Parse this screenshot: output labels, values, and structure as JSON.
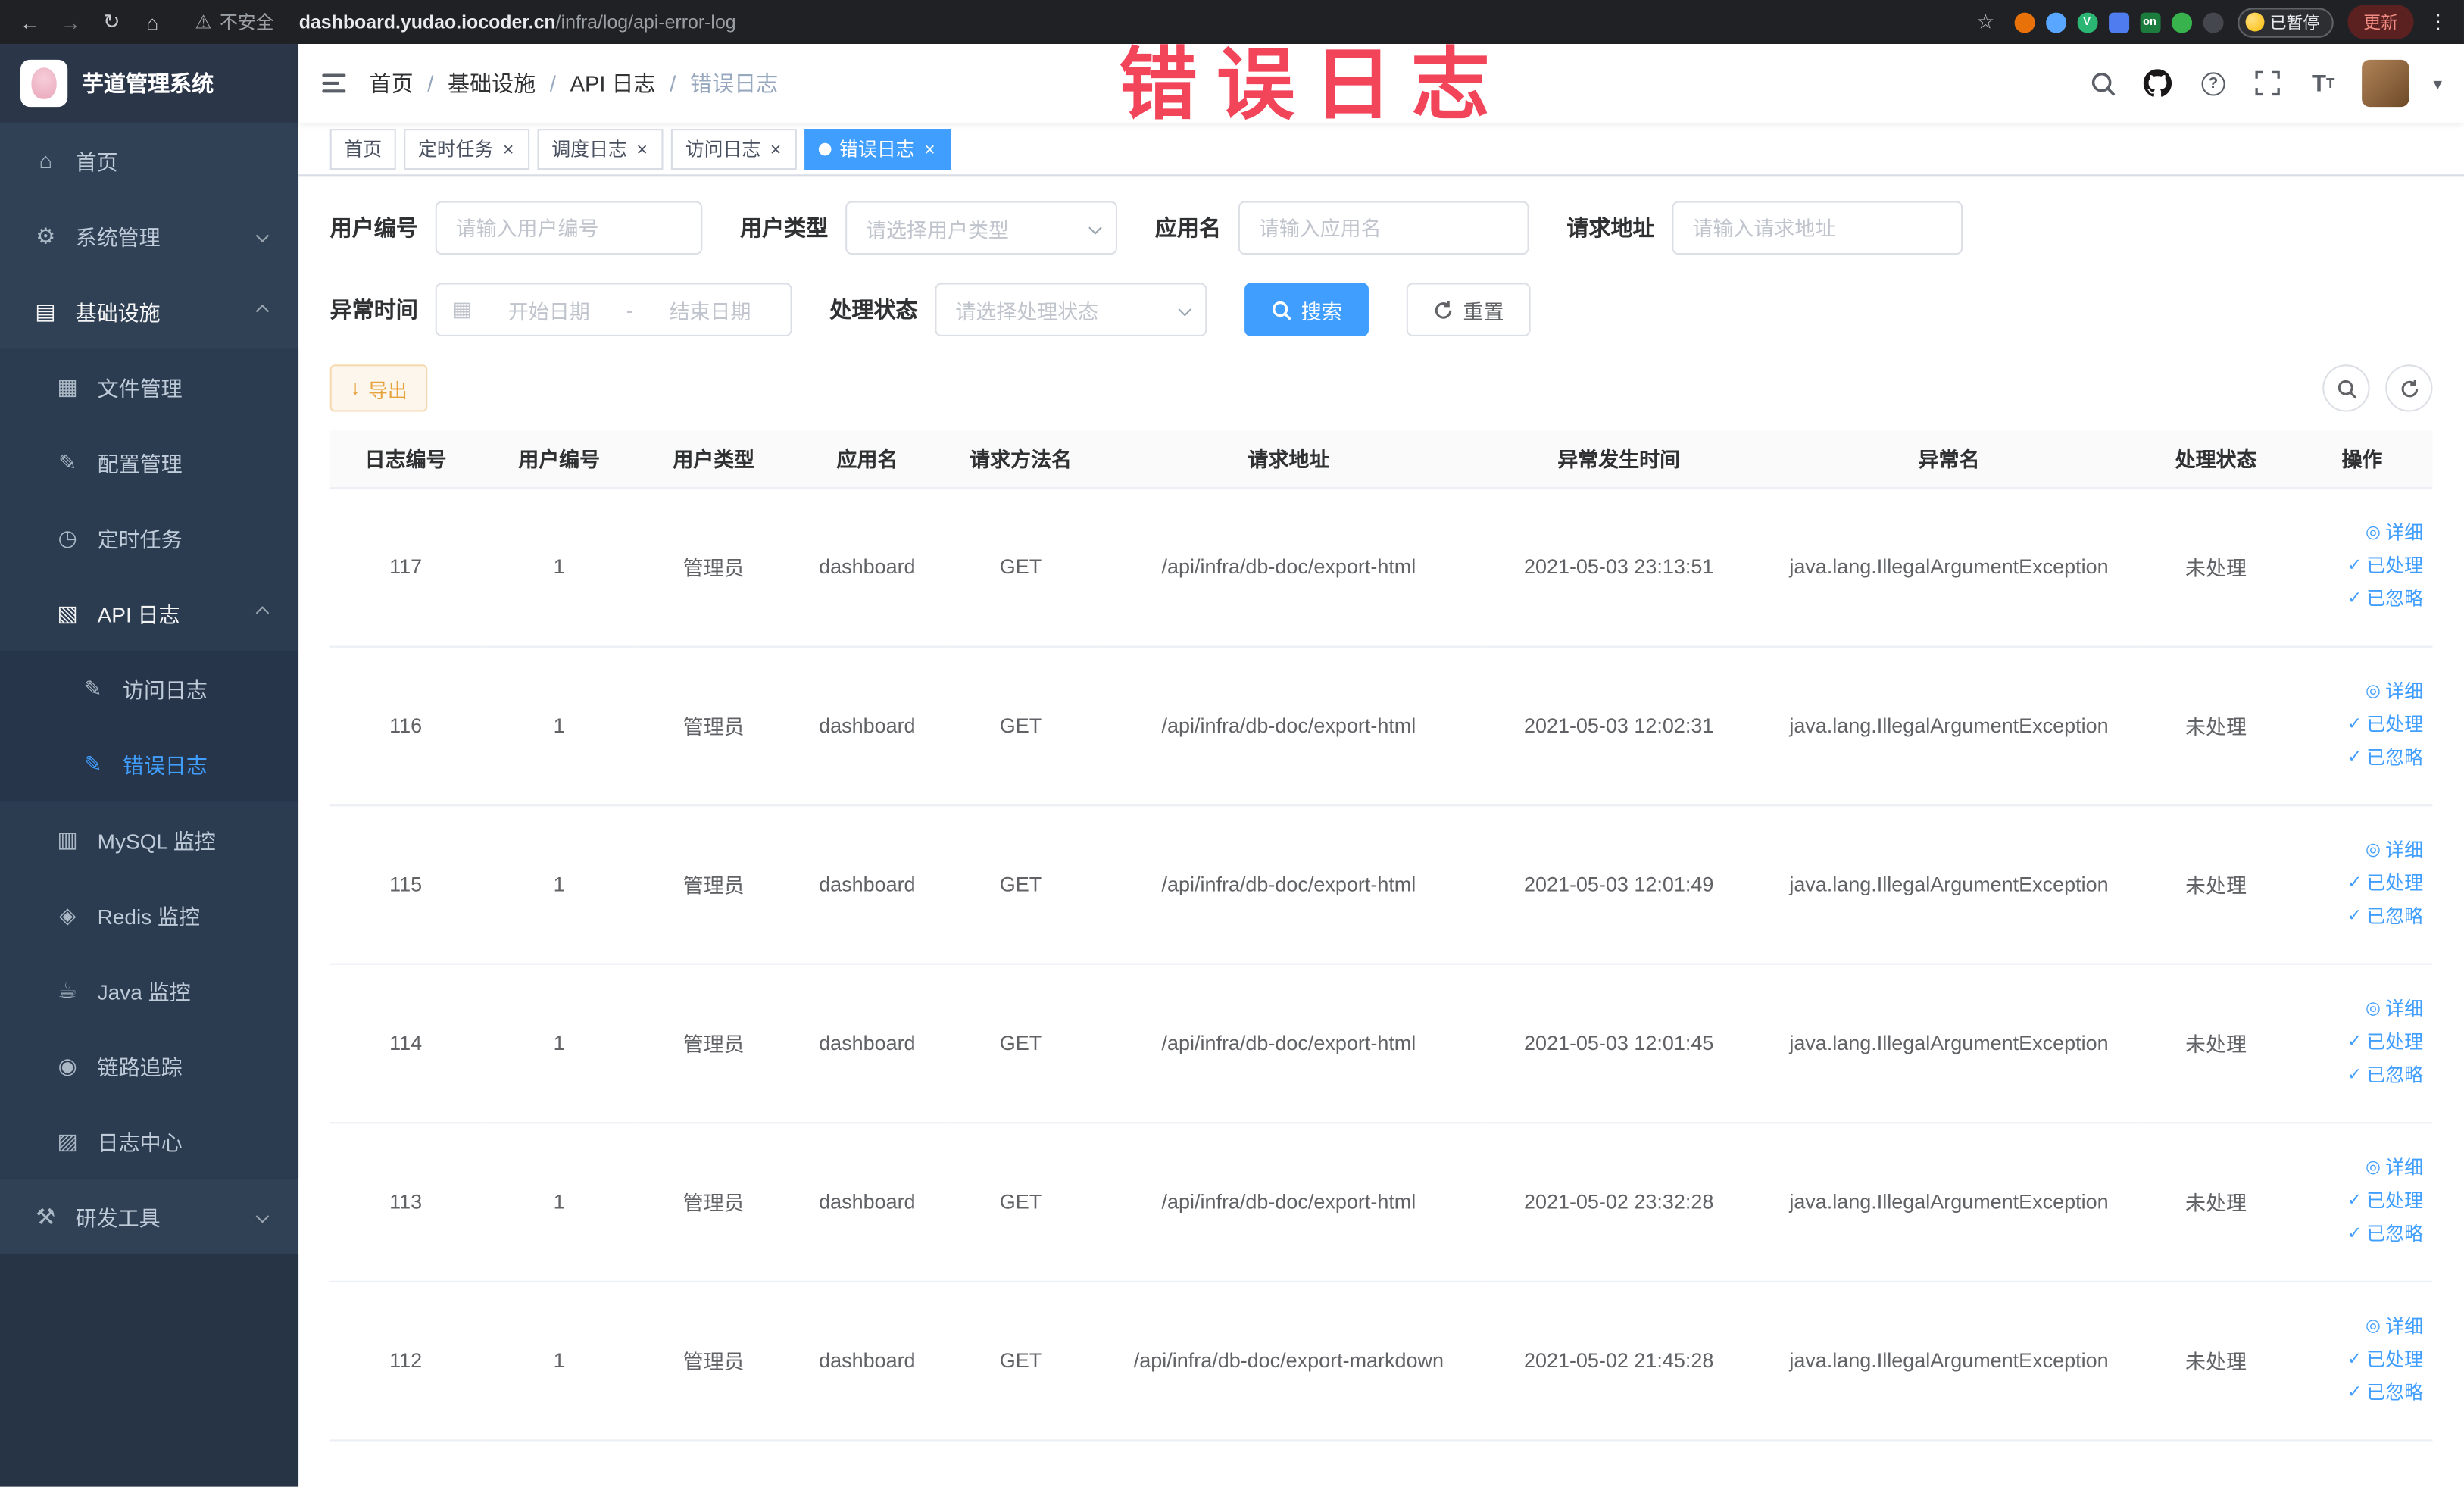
{
  "watermark": "错误日志",
  "browser": {
    "security_label": "不安全",
    "url_domain": "dashboard.yudao.iocoder.cn",
    "url_path": "/infra/log/api-error-log",
    "paused_badge": "已暂停",
    "update_button": "更新",
    "extensions": [
      {
        "name": "extension-orange-icon",
        "color": "#e8710a",
        "shape": "circle",
        "text": ""
      },
      {
        "name": "extension-drop-icon",
        "color": "#58a6ff",
        "shape": "circle",
        "text": ""
      },
      {
        "name": "extension-v-icon",
        "color": "#2bb673",
        "shape": "circle",
        "text": "V"
      },
      {
        "name": "extension-grid-icon",
        "color": "#4f7df0",
        "shape": "square",
        "text": ""
      },
      {
        "name": "extension-on-icon",
        "color": "#1c7c3e",
        "shape": "square",
        "text": "on"
      },
      {
        "name": "extension-leaf-icon",
        "color": "#37b24d",
        "shape": "circle",
        "text": ""
      },
      {
        "name": "extension-paw-icon",
        "color": "#44474d",
        "shape": "circle",
        "text": ""
      }
    ]
  },
  "sidebar": {
    "logo_title": "芋道管理系统",
    "menu": [
      {
        "name": "home",
        "label": "首页",
        "icon": "home-icon",
        "level": 1,
        "chevron": null,
        "active": false,
        "highlight": false
      },
      {
        "name": "system-management",
        "label": "系统管理",
        "icon": "gear-icon",
        "level": 1,
        "chevron": "down",
        "active": false,
        "highlight": false
      },
      {
        "name": "infrastructure",
        "label": "基础设施",
        "icon": "infrastructure-icon",
        "level": 1,
        "chevron": "up",
        "active": false,
        "highlight": true
      },
      {
        "name": "file-management",
        "label": "文件管理",
        "icon": "file-icon",
        "level": 2,
        "chevron": null,
        "active": false,
        "highlight": false
      },
      {
        "name": "config-management",
        "label": "配置管理",
        "icon": "config-icon",
        "level": 2,
        "chevron": null,
        "active": false,
        "highlight": false
      },
      {
        "name": "scheduled-tasks",
        "label": "定时任务",
        "icon": "timer-icon",
        "level": 2,
        "chevron": null,
        "active": false,
        "highlight": false
      },
      {
        "name": "api-log",
        "label": "API 日志",
        "icon": "api-log-icon",
        "level": 2,
        "chevron": "up",
        "active": false,
        "highlight": true
      },
      {
        "name": "access-log",
        "label": "访问日志",
        "icon": "access-log-icon",
        "level": 3,
        "chevron": null,
        "active": false,
        "highlight": false
      },
      {
        "name": "error-log",
        "label": "错误日志",
        "icon": "error-log-icon",
        "level": 3,
        "chevron": null,
        "active": true,
        "highlight": false
      },
      {
        "name": "mysql-monitor",
        "label": "MySQL 监控",
        "icon": "mysql-icon",
        "level": 2,
        "chevron": null,
        "active": false,
        "highlight": false
      },
      {
        "name": "redis-monitor",
        "label": "Redis 监控",
        "icon": "redis-icon",
        "level": 2,
        "chevron": null,
        "active": false,
        "highlight": false
      },
      {
        "name": "java-monitor",
        "label": "Java 监控",
        "icon": "java-icon",
        "level": 2,
        "chevron": null,
        "active": false,
        "highlight": false
      },
      {
        "name": "trace",
        "label": "链路追踪",
        "icon": "trace-icon",
        "level": 2,
        "chevron": null,
        "active": false,
        "highlight": false
      },
      {
        "name": "log-center",
        "label": "日志中心",
        "icon": "log-center-icon",
        "level": 2,
        "chevron": null,
        "active": false,
        "highlight": false
      },
      {
        "name": "dev-tools",
        "label": "研发工具",
        "icon": "devtools-icon",
        "level": 1,
        "chevron": "down",
        "active": false,
        "highlight": false
      }
    ]
  },
  "header": {
    "breadcrumb": [
      "首页",
      "基础设施",
      "API 日志",
      "错误日志"
    ],
    "breadcrumb_separator": "/"
  },
  "tags_view": [
    {
      "name": "home",
      "label": "首页",
      "closable": false,
      "active": false
    },
    {
      "name": "scheduled-tasks",
      "label": "定时任务",
      "closable": true,
      "active": false
    },
    {
      "name": "schedule-log",
      "label": "调度日志",
      "closable": true,
      "active": false
    },
    {
      "name": "access-log",
      "label": "访问日志",
      "closable": true,
      "active": false
    },
    {
      "name": "error-log",
      "label": "错误日志",
      "closable": true,
      "active": true
    }
  ],
  "filters": {
    "user_id": {
      "label": "用户编号",
      "placeholder": "请输入用户编号"
    },
    "user_type": {
      "label": "用户类型",
      "placeholder": "请选择用户类型"
    },
    "app_name": {
      "label": "应用名",
      "placeholder": "请输入应用名"
    },
    "request_url": {
      "label": "请求地址",
      "placeholder": "请输入请求地址"
    },
    "exception_time": {
      "label": "异常时间",
      "start_placeholder": "开始日期",
      "separator": "-",
      "end_placeholder": "结束日期"
    },
    "process_status": {
      "label": "处理状态",
      "placeholder": "请选择处理状态"
    },
    "search_button": "搜索",
    "reset_button": "重置"
  },
  "toolbar": {
    "export_label": "导出"
  },
  "table": {
    "columns": [
      "日志编号",
      "用户编号",
      "用户类型",
      "应用名",
      "请求方法名",
      "请求地址",
      "异常发生时间",
      "异常名",
      "处理状态",
      "操作"
    ],
    "rows": [
      {
        "id": "117",
        "user_id": "1",
        "user_type": "管理员",
        "app": "dashboard",
        "method": "GET",
        "url": "/api/infra/db-doc/export-html",
        "time": "2021-05-03 23:13:51",
        "exception": "java.lang.IllegalArgumentException",
        "status": "未处理"
      },
      {
        "id": "116",
        "user_id": "1",
        "user_type": "管理员",
        "app": "dashboard",
        "method": "GET",
        "url": "/api/infra/db-doc/export-html",
        "time": "2021-05-03 12:02:31",
        "exception": "java.lang.IllegalArgumentException",
        "status": "未处理"
      },
      {
        "id": "115",
        "user_id": "1",
        "user_type": "管理员",
        "app": "dashboard",
        "method": "GET",
        "url": "/api/infra/db-doc/export-html",
        "time": "2021-05-03 12:01:49",
        "exception": "java.lang.IllegalArgumentException",
        "status": "未处理"
      },
      {
        "id": "114",
        "user_id": "1",
        "user_type": "管理员",
        "app": "dashboard",
        "method": "GET",
        "url": "/api/infra/db-doc/export-html",
        "time": "2021-05-03 12:01:45",
        "exception": "java.lang.IllegalArgumentException",
        "status": "未处理"
      },
      {
        "id": "113",
        "user_id": "1",
        "user_type": "管理员",
        "app": "dashboard",
        "method": "GET",
        "url": "/api/infra/db-doc/export-html",
        "time": "2021-05-02 23:32:28",
        "exception": "java.lang.IllegalArgumentException",
        "status": "未处理"
      },
      {
        "id": "112",
        "user_id": "1",
        "user_type": "管理员",
        "app": "dashboard",
        "method": "GET",
        "url": "/api/infra/db-doc/export-markdown",
        "time": "2021-05-02 21:45:28",
        "exception": "java.lang.IllegalArgumentException",
        "status": "未处理"
      }
    ],
    "actions": [
      {
        "name": "detail",
        "label": "详细",
        "icon": "eye-icon"
      },
      {
        "name": "processed",
        "label": "已处理",
        "icon": "check-icon"
      },
      {
        "name": "ignored",
        "label": "已忽略",
        "icon": "check-icon"
      }
    ]
  },
  "icons": {
    "back-icon": "←",
    "forward-icon": "→",
    "reload-icon": "↻",
    "home-browser-icon": "⌂",
    "warning-icon": "⚠",
    "star-icon": "☆",
    "kebab-icon": "⋮",
    "home-icon": "⌂",
    "gear-icon": "⚙",
    "infrastructure-icon": "▤",
    "file-icon": "▦",
    "config-icon": "✎",
    "timer-icon": "◷",
    "api-log-icon": "▧",
    "access-log-icon": "✎",
    "error-log-icon": "✎",
    "mysql-icon": "▥",
    "redis-icon": "◈",
    "java-icon": "☕",
    "trace-icon": "◉",
    "log-center-icon": "▨",
    "devtools-icon": "⚒",
    "close-icon": "×",
    "caret-down-icon": "▾",
    "calendar-icon": "▦",
    "download-icon": "↓",
    "eye-icon": "◎",
    "check-icon": "✓",
    "question-icon": "?",
    "font-size-icon": "T"
  },
  "colors": {
    "primary": "#409eff",
    "warning": "#e6a23c",
    "sidebar_bg": "#304156",
    "watermark": "#f2455a"
  }
}
